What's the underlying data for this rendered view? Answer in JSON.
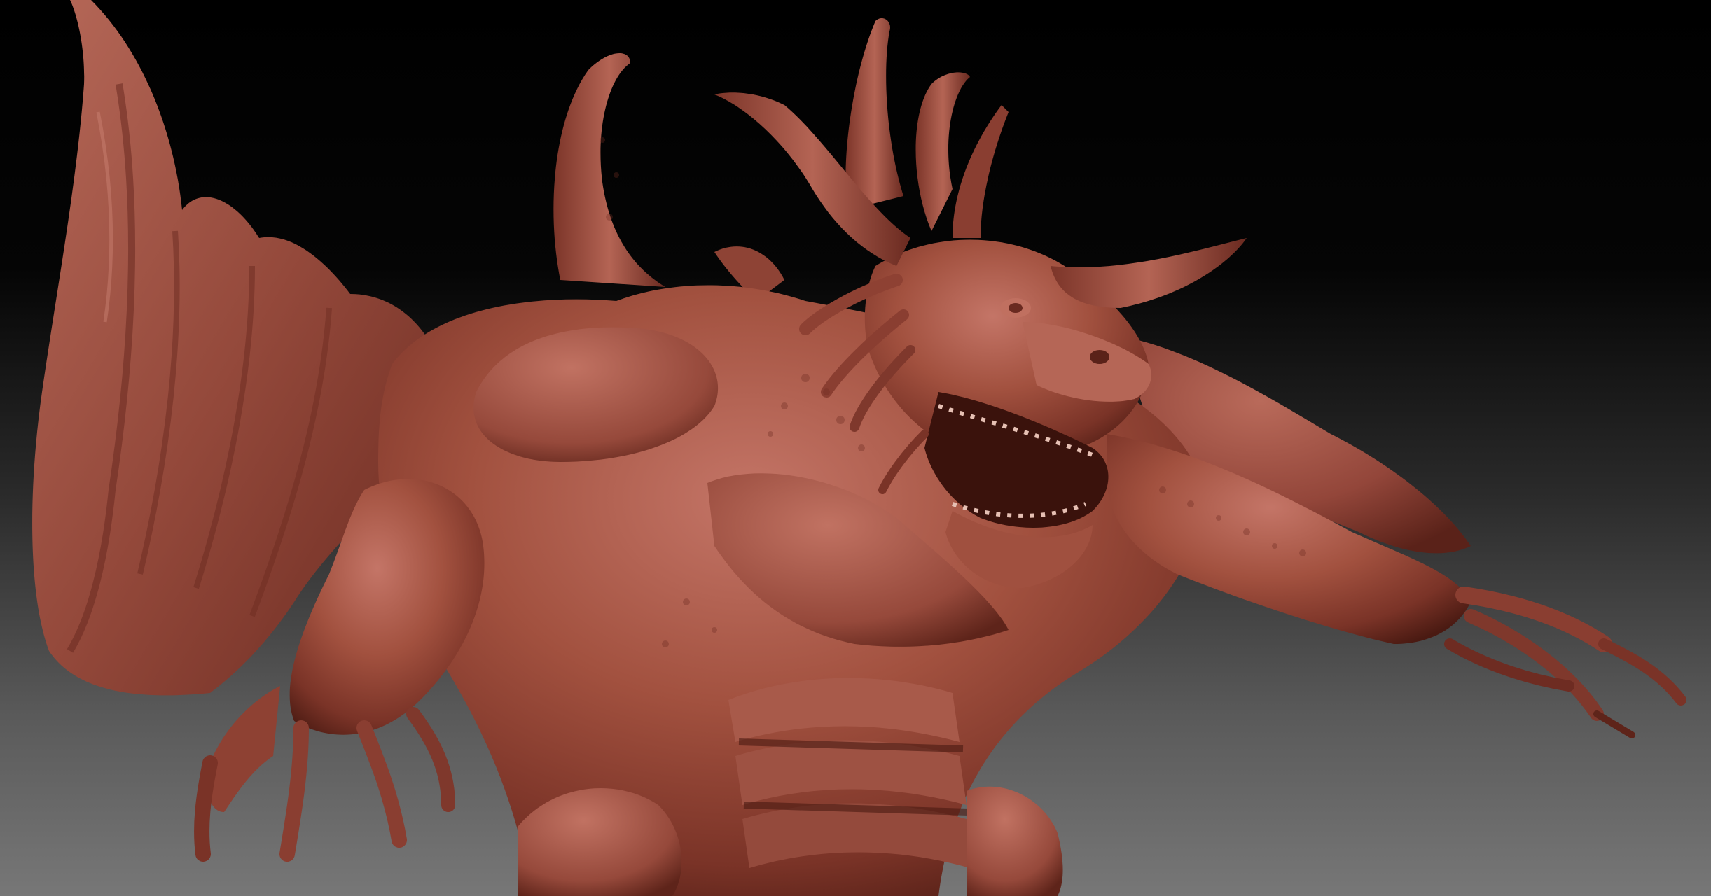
{
  "scene": {
    "background_top": "#000000",
    "background_bottom": "#777777",
    "material_base": "#9a4a3e",
    "material_highlight": "#c77a6b",
    "material_shadow": "#3e1510"
  }
}
